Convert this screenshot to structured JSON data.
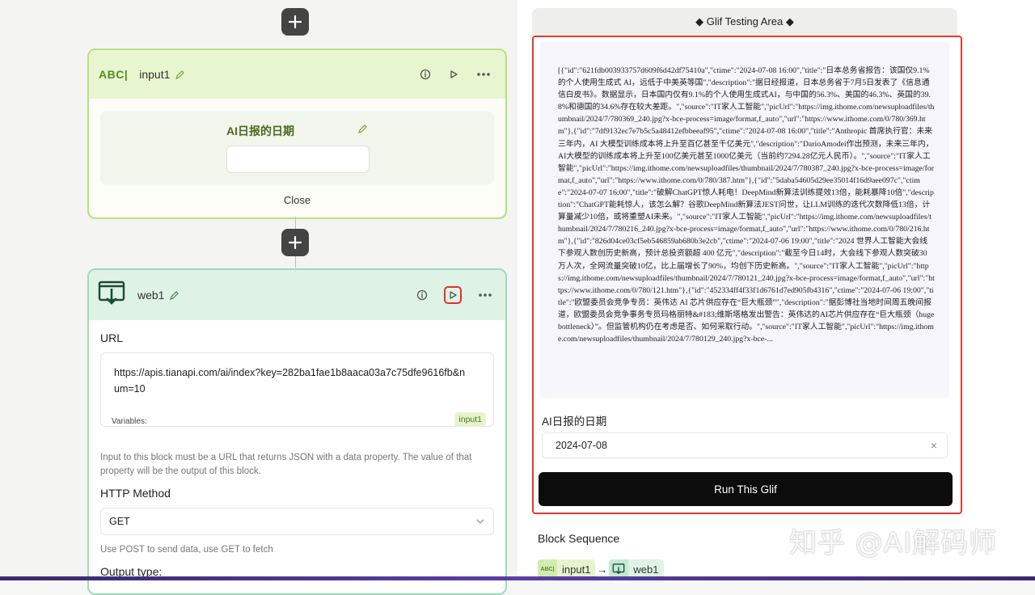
{
  "input_block": {
    "type_badge": "ABC|",
    "name": "input1",
    "field_label": "AI日报的日期",
    "close_label": "Close"
  },
  "web_block": {
    "name": "web1",
    "url_label": "URL",
    "url_value": "https://apis.tianapi.com/ai/index?key=282ba1fae1b8aaca03a7c75dfe9616fb&num=10",
    "variables_label": "Variables:",
    "variable_chip": "input1",
    "help_text": "Input to this block must be a URL that returns JSON with a data property. The value of that property will be the output of this block.",
    "method_label": "HTTP Method",
    "method_value": "GET",
    "method_help": "Use POST to send data, use GET to fetch",
    "output_label": "Output type:"
  },
  "test_area": {
    "header": "◆ Glif Testing Area ◆",
    "output_text": "[{\"id\":\"621fdb003933757d609f6d42df75410a\",\"ctime\":\"2024-07-08 16:00\",\"title\":\"日本总务省报告：该国仅9.1% 的个人使用生成式 AI，远低于中美英等国\",\"description\":\"据日经报道，日本总务省于7月5日发表了《信息通信白皮书》。数据显示，日本国内仅有9.1%的个人使用生成式AI，与中国的56.3%、美国的46.3%、英国的39.8%和德国的34.6%存在较大差距。\",\"source\":\"IT家人工智能\",\"picUrl\":\"https://img.ithome.com/newsuploadfiles/thumbnail/2024/7/780369_240.jpg?x-bce-process=image/format,f_auto\",\"url\":\"https://www.ithome.com/0/780/369.htm\"},{\"id\":\"7df9132ec7e7b5c5a48412efbbeeaf95\",\"ctime\":\"2024-07-08 16:00\",\"title\":\"Anthropic 首席执行官：未来三年内，AI 大模型训练成本将上升至百亿甚至千亿美元\",\"description\":\"DarioAmodei作出预测，未来三年内，AI大模型的训练成本将上升至100亿美元甚至1000亿美元（当前约7294.28亿元人民币）。\",\"source\":\"IT家人工智能\",\"picUrl\":\"https://img.ithome.com/newsuploadfiles/thumbnail/2024/7/780387_240.jpg?x-bce-process=image/format,f_auto\",\"url\":\"https://www.ithome.com/0/780/387.htm\"},{\"id\":\"5daba54605d29ee35014f16d9aee097c\",\"ctime\":\"2024-07-07 16:00\",\"title\":\"破解ChatGPT惊人耗电！DeepMind新算法训练提效13倍，能耗暴降10倍\",\"description\":\"ChatGPT能耗惊人，该怎么解？谷歌DeepMind新算法JEST问世，让LLM训练的迭代次数降低13倍，计算量减少10倍，或将重塑AI未来。\",\"source\":\"IT家人工智能\",\"picUrl\":\"https://img.ithome.com/newsuploadfiles/thumbnail/2024/7/780216_240.jpg?x-bce-process=image/format,f_auto\",\"url\":\"https://www.ithome.com/0/780/216.htm\"},{\"id\":\"826d04ce03cf5eb546859ab680b3e2cb\",\"ctime\":\"2024-07-06 19:00\",\"title\":\"2024 世界人工智能大会线下参观人数创历史新高，预计总投资额超 400 亿元\",\"description\":\"截至今日14时，大会线下参观人数突破30万人次，全网流量突破10亿，比上届增长了90%，均创下历史新高。\",\"source\":\"IT家人工智能\",\"picUrl\":\"https://img.ithome.com/newsuploadfiles/thumbnail/2024/7/780121_240.jpg?x-bce-process=image/format,f_auto\",\"url\":\"https://www.ithome.com/0/780/121.htm\"},{\"id\":\"452334ff4f33f1d6761d7ed905fb4316\",\"ctime\":\"2024-07-06 19:00\",\"title\":\"欧盟委员会竞争专员：英伟达 AI 芯片供应存在“巨大瓶颈”\",\"description\":\"据彭博社当地时间周五晚间报道，欧盟委员会竞争事务专员玛格丽特&#183;维斯塔格发出警告：英伟达的AI芯片供应存在“巨大瓶颈（hugebottleneck）”。但监管机构仍在考虑是否、如何采取行动。\",\"source\":\"IT家人工智能\",\"picUrl\":\"https://img.ithome.com/newsuploadfiles/thumbnail/2024/7/780129_240.jpg?x-bce-...",
    "date_label": "AI日报的日期",
    "date_value": "2024-07-08",
    "clear_glyph": "×",
    "run_button": "Run This Glif"
  },
  "sequence": {
    "title": "Block Sequence",
    "items": [
      {
        "badge": "ABC|",
        "label": "input1"
      },
      {
        "arrow": "→"
      },
      {
        "label": "web1"
      }
    ]
  },
  "watermark": "知乎 @AI解码师",
  "colors": {
    "input_border": "#b9e07f",
    "web_border": "#9fd9b8",
    "highlight_red": "#e23b2e",
    "run_button_bg": "#0c0c0c"
  },
  "icons": {
    "add": "plus-icon",
    "edit": "pencil-icon",
    "info": "info-icon",
    "run": "play-icon",
    "more": "more-dots-icon",
    "web": "download-monitor-icon",
    "dropdown": "chevron-down-icon"
  }
}
